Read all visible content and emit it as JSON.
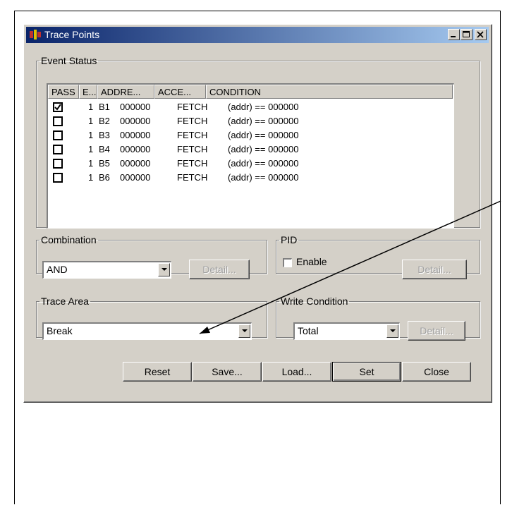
{
  "dialog": {
    "title": "Trace Points",
    "window_buttons": [
      "minimize-icon",
      "maximize-icon",
      "close-icon"
    ]
  },
  "event_status": {
    "legend": "Event Status",
    "columns": [
      "PASS",
      "E...",
      "ADDRE...",
      "ACCE...",
      "CONDITION"
    ],
    "rows": [
      {
        "checked": true,
        "count": "1",
        "event": "B1",
        "address": "000000",
        "access": "FETCH",
        "condition": "(addr) == 000000"
      },
      {
        "checked": false,
        "count": "1",
        "event": "B2",
        "address": "000000",
        "access": "FETCH",
        "condition": "(addr) == 000000"
      },
      {
        "checked": false,
        "count": "1",
        "event": "B3",
        "address": "000000",
        "access": "FETCH",
        "condition": "(addr) == 000000"
      },
      {
        "checked": false,
        "count": "1",
        "event": "B4",
        "address": "000000",
        "access": "FETCH",
        "condition": "(addr) == 000000"
      },
      {
        "checked": false,
        "count": "1",
        "event": "B5",
        "address": "000000",
        "access": "FETCH",
        "condition": "(addr) == 000000"
      },
      {
        "checked": false,
        "count": "1",
        "event": "B6",
        "address": "000000",
        "access": "FETCH",
        "condition": "(addr) == 000000"
      }
    ]
  },
  "combination": {
    "legend": "Combination",
    "value": "AND",
    "detail_label": "Detail..."
  },
  "pid": {
    "legend": "PID",
    "enable_label": "Enable",
    "enabled": false,
    "detail_label": "Detail..."
  },
  "trace_area": {
    "legend": "Trace Area",
    "value": "Break"
  },
  "write_condition": {
    "legend": "Write Condition",
    "value": "Total",
    "detail_label": "Detail..."
  },
  "buttons": {
    "reset": "Reset",
    "save": "Save...",
    "load": "Load...",
    "set": "Set",
    "close": "Close"
  },
  "colors": {
    "titlebar_start": "#0a246a",
    "titlebar_end": "#a6caf0",
    "dialog_bg": "#d4d0c8"
  }
}
